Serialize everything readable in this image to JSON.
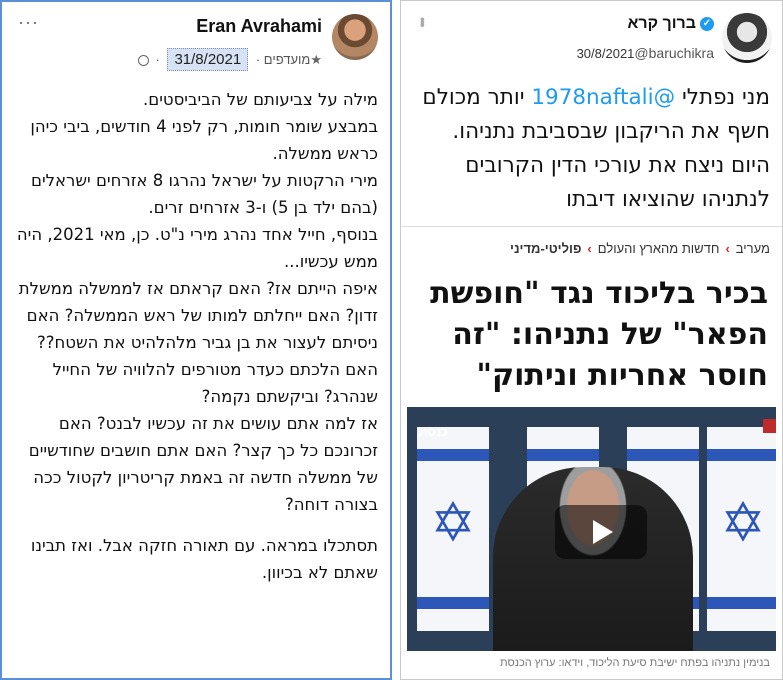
{
  "facebook_post": {
    "author": "Eran Avrahami",
    "date": "31/8/2021",
    "audience_label": "מועדפים",
    "more_options": "···",
    "paragraphs": [
      "מילה על צביעותם של הביביסטים.",
      "במבצע שומר חומות, רק לפני 4 חודשים, ביבי כיהן כראש ממשלה.",
      "מירי הרקטות על ישראל נהרגו 8 אזרחים ישראלים (בהם ילד בן 5) ו-3 אזרחים זרים.",
      "בנוסף, חייל אחד נהרג מירי נ\"ט. כן, מאי 2021, היה ממש עכשיו...",
      "איפה הייתם אז? האם קראתם אז לממשלה ממשלת זדון? האם ייחלתם למותו של ראש הממשלה? האם ניסיתם לעצור את בן גביר מלהלהיט את השטח??",
      "האם הלכתם כעדר מטורפים להלוויה של החייל שנהרג? וביקשתם נקמה?",
      "אז למה אתם עושים את זה עכשיו לבנט? האם זכרונכם כל כך קצר? האם אתם חושבים שחודשיים של ממשלה חדשה זה באמת קריטריון לקטול ככה בצורה דוחה?",
      "",
      "תסתכלו במראה. עם תאורה חזקה אבל. ואז תבינו שאתם לא בכיוון."
    ]
  },
  "tweet": {
    "author": "ברוך קרא",
    "handle": "@baruchikra",
    "date": "30/8/2021",
    "verified_icon": "verified-badge-icon",
    "text_before": "מני נפתלי ",
    "mention": "@1978naftali",
    "text_after": " יותר מכולם חשף את הריקבון שבסביבת נתניהו. היום ניצח את עורכי הדין הקרובים לנתניהו שהוציאו דיבתו"
  },
  "article_card": {
    "breadcrumb": [
      "מעריב",
      "חדשות מהארץ והעולם",
      "פוליטי-מדיני"
    ],
    "headline": "בכיר בליכוד נגד \"חופשת הפאר\" של נתניהו: \"זה חוסר אחריות וניתוק\"",
    "video_logo": "כנסת",
    "caption": "בנימין נתניהו בפתח ישיבת סיעת הליכוד, וידאו: ערוץ הכנסת"
  },
  "colors": {
    "highlight_border": "#5b8fd6",
    "date_highlight": "#d7e3f4",
    "mention_blue": "#1d9bf0",
    "breadcrumb_red": "#d62b2b"
  }
}
